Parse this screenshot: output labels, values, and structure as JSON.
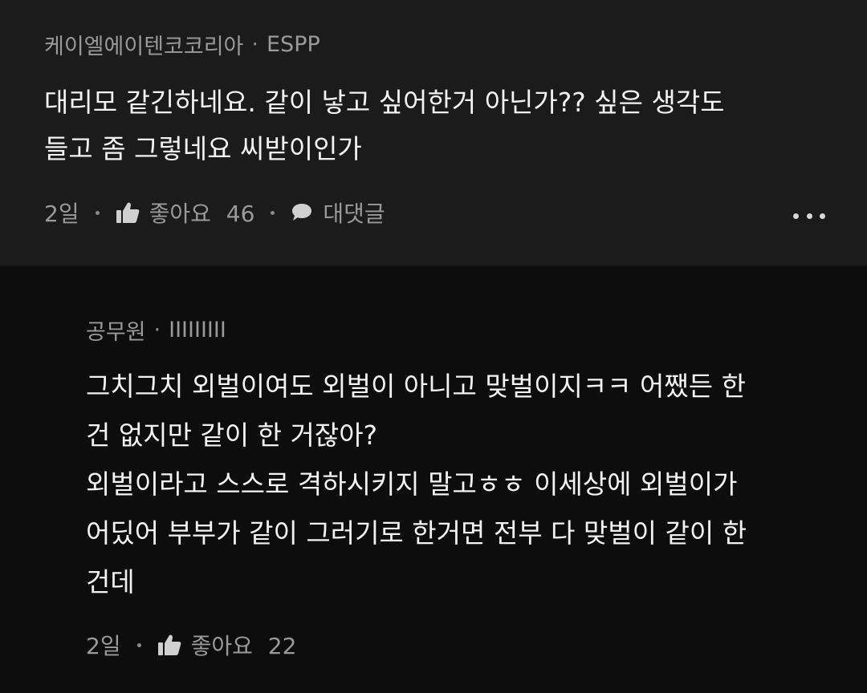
{
  "comments": [
    {
      "author": "케이엘에이텐코코리아",
      "nickname": "ESPP",
      "text": "대리모 같긴하네요. 같이 낳고 싶어한거 아닌가?? 싶은 생각도\n들고 좀 그렇네요 씨받이인가",
      "time": "2일",
      "like_label": "좋아요",
      "like_count": "46",
      "reply_label": "대댓글",
      "icons": [
        "thumbs-up-icon",
        "speech-bubble-icon",
        "more-icon"
      ]
    }
  ],
  "reply": {
    "author": "공무원",
    "nickname": "IIIIIIIII",
    "text": "그치그치 외벌이여도 외벌이 아니고 맞벌이지ㅋㅋ 어쨌든 한\n건 없지만 같이 한 거잖아?\n외벌이라고 스스로 격하시키지 말고ㅎㅎ 이세상에 외벌이가\n어딨어 부부가 같이 그러기로 한거면 전부 다 맞벌이 같이 한\n건데",
    "time": "2일",
    "like_label": "좋아요",
    "like_count": "22",
    "icons": [
      "thumbs-up-icon"
    ]
  },
  "separator": "·",
  "colors": {
    "top_bg": "#1b1b1b",
    "reply_bg": "#0d0d0d",
    "text": "#f3f3f3",
    "muted": "#9a9a9a"
  }
}
